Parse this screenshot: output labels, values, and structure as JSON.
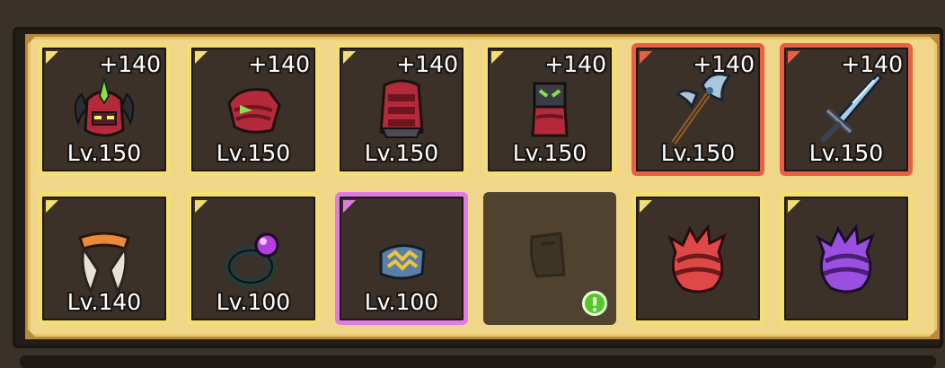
{
  "equipment": {
    "row1": [
      {
        "name": "helmet",
        "enhance": "+140",
        "level": "Lv.150",
        "rarity": "gold",
        "icon": "horned-helmet-icon"
      },
      {
        "name": "shoulder",
        "enhance": "+140",
        "level": "Lv.150",
        "rarity": "gold",
        "icon": "shoulder-armor-icon"
      },
      {
        "name": "chest",
        "enhance": "+140",
        "level": "Lv.150",
        "rarity": "gold",
        "icon": "chest-armor-icon"
      },
      {
        "name": "gloves",
        "enhance": "+140",
        "level": "Lv.150",
        "rarity": "gold",
        "icon": "gauntlet-icon"
      },
      {
        "name": "axe",
        "enhance": "+140",
        "level": "Lv.150",
        "rarity": "red",
        "icon": "battle-axe-icon"
      },
      {
        "name": "sword",
        "enhance": "+140",
        "level": "Lv.150",
        "rarity": "red",
        "icon": "sword-icon"
      }
    ],
    "row2": [
      {
        "name": "cape",
        "level": "Lv.140",
        "rarity": "gold",
        "icon": "cape-icon"
      },
      {
        "name": "ring",
        "level": "Lv.100",
        "rarity": "gold",
        "icon": "ring-icon"
      },
      {
        "name": "bracelet",
        "level": "Lv.100",
        "rarity": "purple",
        "icon": "bracelet-icon"
      },
      {
        "name": "empty",
        "rarity": "empty",
        "icon": "empty-slot-icon",
        "alert": true
      },
      {
        "name": "red-egg",
        "rarity": "gold",
        "icon": "red-spiked-egg-icon"
      },
      {
        "name": "purple-egg",
        "rarity": "gold",
        "icon": "purple-spiked-egg-icon"
      }
    ]
  },
  "colors": {
    "gold_border": "#f3de73",
    "red_border": "#ec5d44",
    "purple_border": "#e07be6",
    "alert": "#55c728"
  }
}
